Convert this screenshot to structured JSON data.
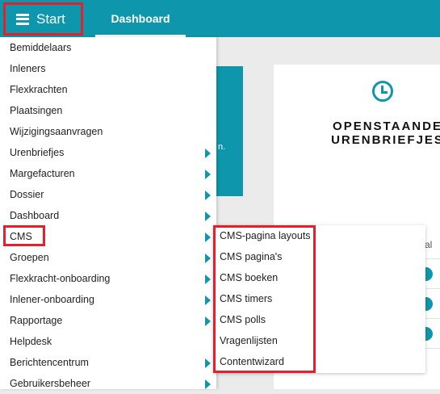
{
  "topbar": {
    "start_label": "Start",
    "dashboard_tab": "Dashboard"
  },
  "background": {
    "tile_text": "n.",
    "card_title_line1": "OPENSTAANDE",
    "card_title_line2": "URENBRIEFJES",
    "card_fragment": "al"
  },
  "menu": {
    "items": [
      {
        "label": "Bemiddelaars",
        "has_submenu": false
      },
      {
        "label": "Inleners",
        "has_submenu": false
      },
      {
        "label": "Flexkrachten",
        "has_submenu": false
      },
      {
        "label": "Plaatsingen",
        "has_submenu": false
      },
      {
        "label": "Wijzigingsaanvragen",
        "has_submenu": false
      },
      {
        "label": "Urenbriefjes",
        "has_submenu": true
      },
      {
        "label": "Margefacturen",
        "has_submenu": true
      },
      {
        "label": "Dossier",
        "has_submenu": true
      },
      {
        "label": "Dashboard",
        "has_submenu": true
      },
      {
        "label": "CMS",
        "has_submenu": true
      },
      {
        "label": "Groepen",
        "has_submenu": true
      },
      {
        "label": "Flexkracht-onboarding",
        "has_submenu": true
      },
      {
        "label": "Inlener-onboarding",
        "has_submenu": true
      },
      {
        "label": "Rapportage",
        "has_submenu": true
      },
      {
        "label": "Helpdesk",
        "has_submenu": false
      },
      {
        "label": "Berichtencentrum",
        "has_submenu": true
      },
      {
        "label": "Gebruikersbeheer",
        "has_submenu": true
      }
    ]
  },
  "submenu": {
    "items": [
      "CMS-pagina layouts",
      "CMS pagina's",
      "CMS boeken",
      "CMS timers",
      "CMS polls",
      "Vragenlijsten",
      "Contentwizard"
    ]
  },
  "colors": {
    "brand": "#0e97ac",
    "highlight": "#e3202b"
  }
}
